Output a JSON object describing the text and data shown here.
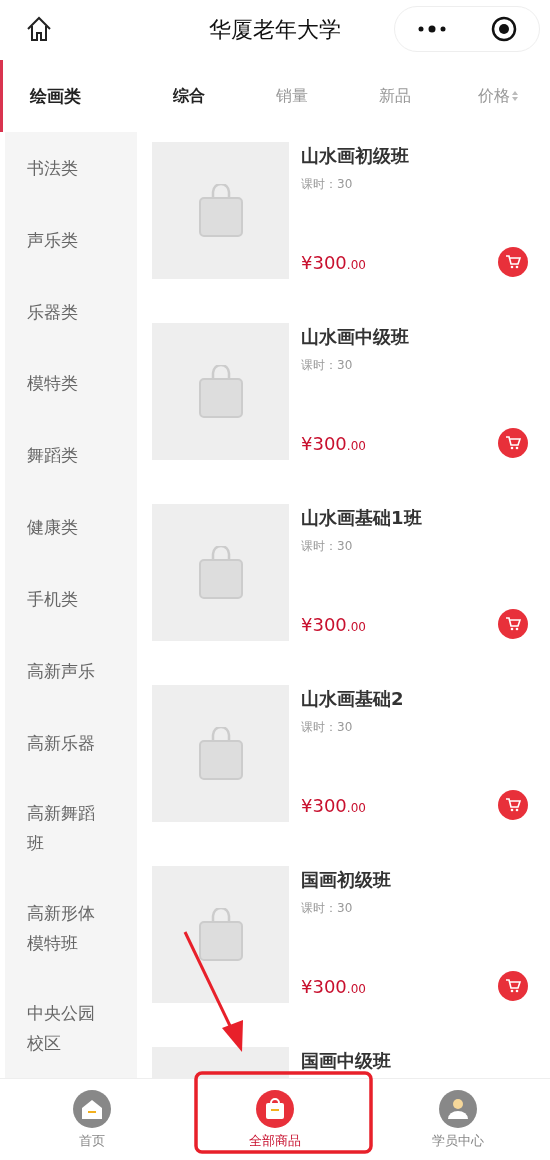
{
  "header": {
    "title": "华厦老年大学"
  },
  "categories": [
    {
      "label": "绘画类",
      "selected": true
    },
    {
      "label": "书法类",
      "selected": false
    },
    {
      "label": "声乐类",
      "selected": false
    },
    {
      "label": "乐器类",
      "selected": false
    },
    {
      "label": "模特类",
      "selected": false
    },
    {
      "label": "舞蹈类",
      "selected": false
    },
    {
      "label": "健康类",
      "selected": false
    },
    {
      "label": "手机类",
      "selected": false
    },
    {
      "label": "高新声乐",
      "selected": false
    },
    {
      "label": "高新乐器",
      "selected": false
    },
    {
      "label": "高新舞蹈班",
      "selected": false
    },
    {
      "label": "高新形体模特班",
      "selected": false
    },
    {
      "label": "中央公园校区",
      "selected": false
    }
  ],
  "sort_tabs": [
    {
      "label": "综合",
      "selected": true,
      "kind": "plain"
    },
    {
      "label": "销量",
      "selected": false,
      "kind": "plain"
    },
    {
      "label": "新品",
      "selected": false,
      "kind": "plain"
    },
    {
      "label": "价格",
      "selected": false,
      "kind": "price"
    }
  ],
  "products": [
    {
      "title": "山水画初级班",
      "hours": "课时：30",
      "price": "¥300",
      "cents": ".00"
    },
    {
      "title": "山水画中级班",
      "hours": "课时：30",
      "price": "¥300",
      "cents": ".00"
    },
    {
      "title": "山水画基础1班",
      "hours": "课时：30",
      "price": "¥300",
      "cents": ".00"
    },
    {
      "title": "山水画基础2",
      "hours": "课时：30",
      "price": "¥300",
      "cents": ".00"
    },
    {
      "title": "国画初级班",
      "hours": "课时：30",
      "price": "¥300",
      "cents": ".00"
    },
    {
      "title": "国画中级班"
    }
  ],
  "tab_bar": [
    {
      "label": "首页",
      "selected": false,
      "kind": "home"
    },
    {
      "label": "全部商品",
      "selected": true,
      "kind": "bag"
    },
    {
      "label": "学员中心",
      "selected": false,
      "kind": "user"
    }
  ]
}
